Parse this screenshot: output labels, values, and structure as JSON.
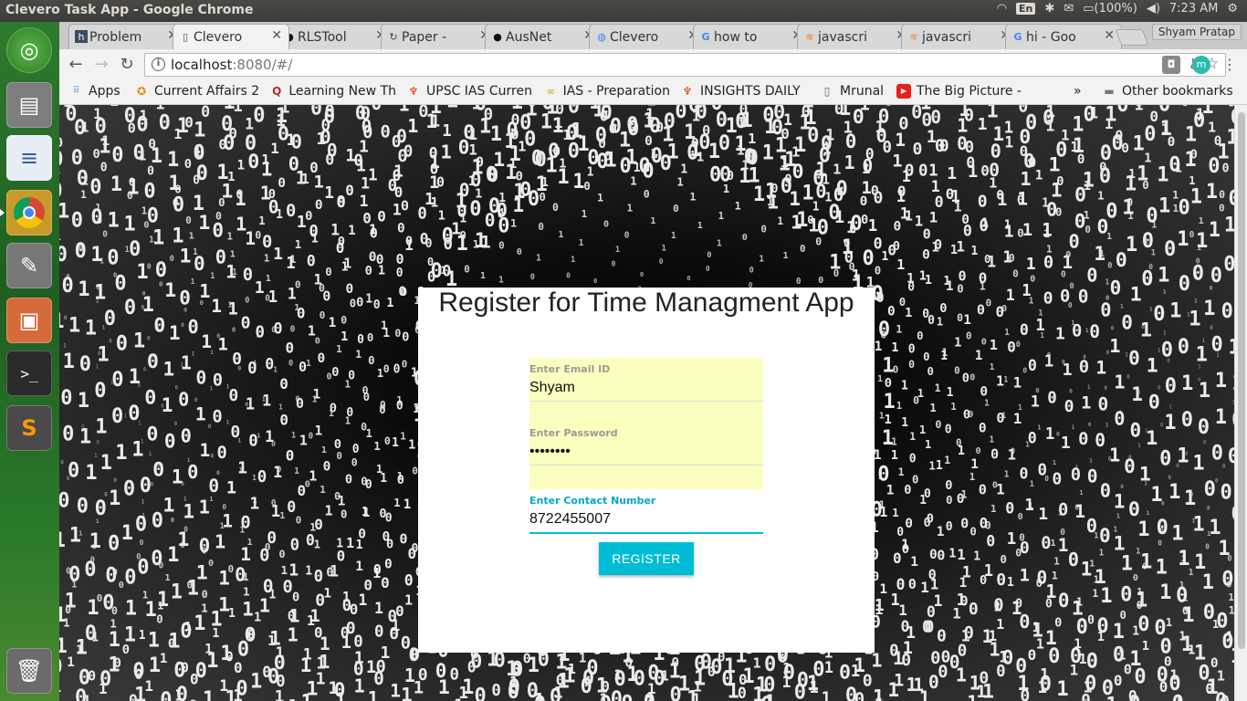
{
  "window": {
    "title": "Clevero Task App - Google Chrome"
  },
  "system_tray": {
    "language": "En",
    "battery": "(100%)",
    "time": "7:23 AM"
  },
  "launcher": {
    "items": [
      "ubuntu-dash",
      "files",
      "libreoffice-writer",
      "chrome",
      "system-settings",
      "archive-manager",
      "terminal",
      "sublime-text",
      "trash"
    ]
  },
  "browser": {
    "profile_name": "Shyam Pratap",
    "tabs": [
      {
        "label": "Problem",
        "icon": "hackerrank-icon"
      },
      {
        "label": "Clevero",
        "icon": "page-icon"
      },
      {
        "label": "RLSTool",
        "icon": "github-icon"
      },
      {
        "label": "Paper -",
        "icon": "paper-icon"
      },
      {
        "label": "AusNet",
        "icon": "github-icon"
      },
      {
        "label": "Clevero",
        "icon": "page-icon"
      },
      {
        "label": "how to",
        "icon": "google-icon"
      },
      {
        "label": "javascri",
        "icon": "stackoverflow-icon"
      },
      {
        "label": "javascri",
        "icon": "stackoverflow-icon"
      },
      {
        "label": "hi - Goo",
        "icon": "google-icon"
      }
    ],
    "active_tab_index": 1,
    "url_host": "localhost",
    "url_rest": ":8080/#/",
    "extension_label": "m",
    "bookmarks": [
      {
        "label": "Apps",
        "icon": "apps-grid-icon"
      },
      {
        "label": "Current Affairs 2",
        "icon": "award-icon"
      },
      {
        "label": "Learning New Th",
        "icon": "q-icon"
      },
      {
        "label": "UPSC IAS Curren",
        "icon": "eagle-icon"
      },
      {
        "label": "IAS - Preparation",
        "icon": "loop-icon"
      },
      {
        "label": "INSIGHTS DAILY",
        "icon": "eagle-icon"
      },
      {
        "label": "Mrunal",
        "icon": "page-icon"
      },
      {
        "label": "The Big Picture -",
        "icon": "youtube-icon"
      }
    ],
    "other_bookmarks": "Other bookmarks"
  },
  "form": {
    "title": "Register for Time Managment App",
    "email": {
      "label": "Enter Email ID",
      "value": "Shyam"
    },
    "password": {
      "label": "Enter Password",
      "value": "••••••••"
    },
    "contact": {
      "label": "Enter Contact Number",
      "value": "8722455007"
    },
    "submit_label": "REGISTER"
  },
  "colors": {
    "accent": "#00bcd4",
    "autofill": "#fbffbd"
  }
}
